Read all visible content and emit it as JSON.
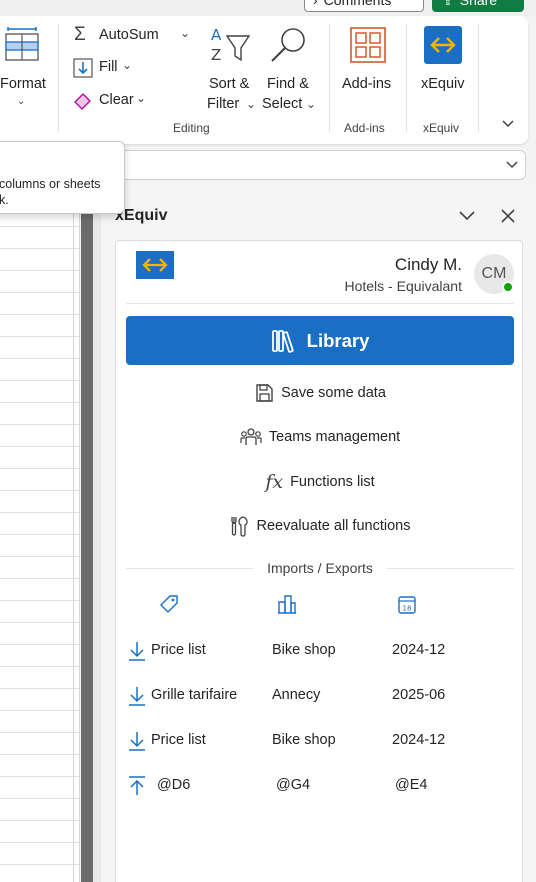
{
  "topbar": {
    "comments_label": "Comments",
    "share_label": "Share"
  },
  "ribbon": {
    "format_label": "Format",
    "autosum_label": "AutoSum",
    "fill_label": "Fill",
    "clear_label": "Clear",
    "sort_label_1": "Sort &",
    "sort_label_2": "Filter",
    "find_label_1": "Find &",
    "find_label_2": "Select",
    "addins_label": "Add-ins",
    "xequiv_label": "xEquiv",
    "group_editing": "Editing",
    "group_addins": "Add-ins",
    "group_xequiv": "xEquiv",
    "colors": {
      "addins_icon": "#d4592a",
      "xequiv_bg": "#1a6fc4",
      "xequiv_arrows": "#f5b400"
    }
  },
  "tooltip": {
    "line1": "columns or sheets",
    "line2": "k."
  },
  "pane": {
    "title": "xEquiv",
    "user": {
      "name": "Cindy M.",
      "org": "Hotels - Equivalant",
      "initials": "CM",
      "presence_color": "#13a10e"
    },
    "library_label": "Library",
    "menu": [
      {
        "label": "Save some data",
        "icon": "save-icon"
      },
      {
        "label": "Teams management",
        "icon": "team-icon"
      },
      {
        "label": "Functions list",
        "icon": "function-icon"
      },
      {
        "label": "Reevaluate all functions",
        "icon": "tools-icon"
      }
    ],
    "section_title": "Imports / Exports",
    "columns": [
      {
        "icon": "tag-icon"
      },
      {
        "icon": "buildings-icon"
      },
      {
        "icon": "calendar-icon"
      }
    ],
    "rows": [
      {
        "type": "import",
        "icon": "download-icon",
        "name": "Price list",
        "place": "Bike shop",
        "date": "2024-12"
      },
      {
        "type": "import",
        "icon": "download-icon",
        "name": "Grille tarifaire",
        "place": "Annecy",
        "date": "2025-06"
      },
      {
        "type": "import",
        "icon": "download-icon",
        "name": "Price list",
        "place": "Bike shop",
        "date": "2024-12"
      },
      {
        "type": "export",
        "icon": "upload-icon",
        "name": "@D6",
        "place": "@G4",
        "date": "@E4"
      }
    ]
  }
}
